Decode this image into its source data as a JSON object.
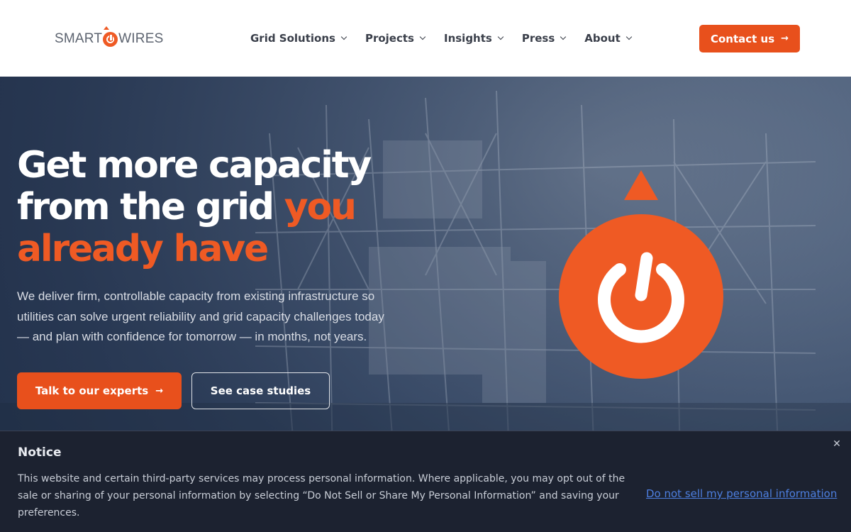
{
  "header": {
    "logo": {
      "left": "SMART",
      "right": "WIRES"
    },
    "nav": [
      {
        "label": "Grid Solutions"
      },
      {
        "label": "Projects"
      },
      {
        "label": "Insights"
      },
      {
        "label": "Press"
      },
      {
        "label": "About"
      }
    ],
    "contact_label": "Contact us",
    "contact_arrow": "→"
  },
  "hero": {
    "title_line1": "Get more capacity",
    "title_line2": "from the grid ",
    "title_accent1": "you",
    "title_accent2": "already have",
    "subtitle": "We deliver firm, controllable capacity from existing infrastructure so utilities can solve urgent reliability and grid capacity challenges today — and plan with confidence for tomorrow — in months, not years.",
    "primary_label": "Talk to our experts",
    "primary_arrow": "→",
    "secondary_label": "See case studies"
  },
  "notice": {
    "title": "Notice",
    "body": "This website and certain third-party services may process personal information. Where applicable, you may opt out of the sale or sharing of your personal information by selecting “Do Not Sell or Share My Personal Information” and saving your preferences.",
    "link": "Do not sell my personal information",
    "close": "✕"
  },
  "colors": {
    "accent": "#e8501c",
    "hero_overlay": "#21304a",
    "notice_bg": "#1c2230",
    "link": "#4d7fe0"
  },
  "icons": [
    "power-icon",
    "arrow-right-icon",
    "chevron-down-icon",
    "close-icon"
  ]
}
